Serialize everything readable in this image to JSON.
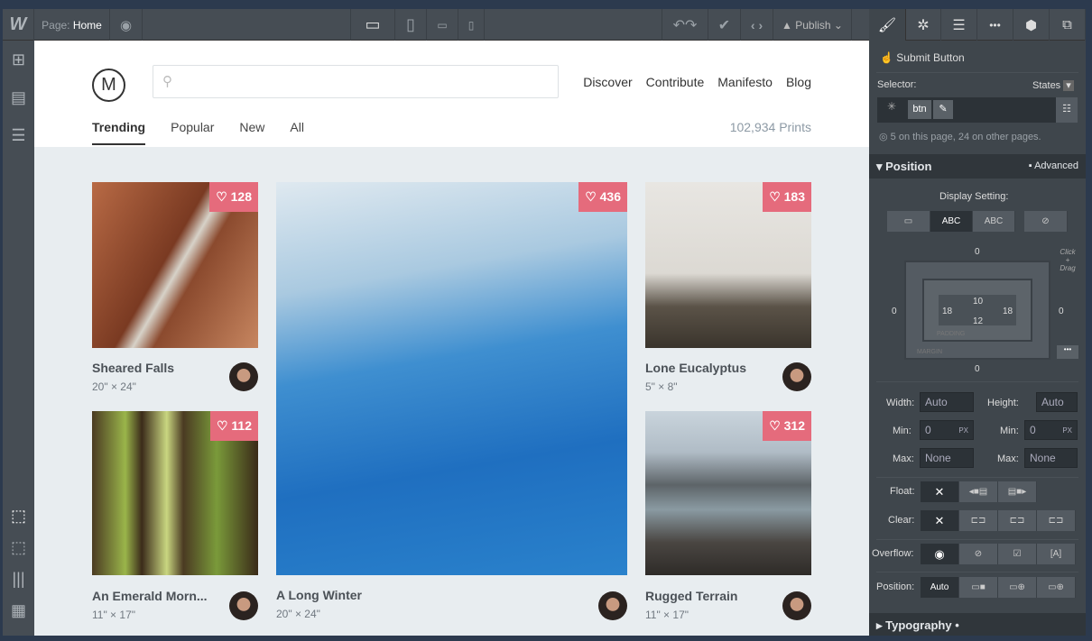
{
  "toolbar": {
    "logo": "W",
    "page_label": "Page:",
    "page_name": "Home",
    "publish": "Publish",
    "icons": [
      "webflow-logo",
      "eye-icon",
      "desktop-icon",
      "tablet-icon",
      "tablet-landscape-icon",
      "phone-icon",
      "undo-redo-icon",
      "check-icon",
      "code-icon",
      "rocket-icon"
    ],
    "panel_tabs": [
      "brush-icon",
      "gear-icon",
      "navigator-icon",
      "drops-icon",
      "cube-icon",
      "images-icon"
    ]
  },
  "sidebar": {
    "top": [
      "add-icon",
      "pages-icon",
      "database-icon"
    ],
    "bottom": [
      "select-icon",
      "preview-icon",
      "grid-icon",
      "layout-icon"
    ]
  },
  "site": {
    "logo": "M",
    "search_placeholder": "",
    "nav": [
      "Discover",
      "Contribute",
      "Manifesto",
      "Blog"
    ],
    "tabs": [
      "Trending",
      "Popular",
      "New",
      "All"
    ],
    "prints": "102,934 Prints",
    "cards": [
      {
        "title": "Sheared Falls",
        "size": "20\" × 24\"",
        "likes": "128"
      },
      {
        "title": "A Long Winter",
        "size": "20\" × 24\"",
        "likes": "436"
      },
      {
        "title": "Lone Eucalyptus",
        "size": "5\" × 8\"",
        "likes": "183"
      },
      {
        "title": "An Emerald Morn...",
        "size": "11\" × 17\"",
        "likes": "112"
      },
      {
        "title": "Rugged Terrain",
        "size": "11\" × 17\"",
        "likes": "312"
      }
    ]
  },
  "panel": {
    "element": "Submit Button",
    "selector_label": "Selector:",
    "states": "States",
    "class": "btn",
    "usage": "5 on this page, 24 on other pages.",
    "position_section": "Position",
    "advanced": "Advanced",
    "display_setting": "Display Setting:",
    "display_opts": [
      "",
      "ABC",
      "ABC",
      ""
    ],
    "box": {
      "margin_top": "0",
      "margin_left": "0",
      "margin_right": "0",
      "margin_bottom": "0",
      "padding_top": "10",
      "padding_left": "18",
      "padding_right": "18",
      "padding_bottom": "12",
      "padding_label": "PADDING",
      "margin_label": "MARGIN",
      "hint": "Click + Drag"
    },
    "width_label": "Width:",
    "width": "Auto",
    "height_label": "Height:",
    "height": "Auto",
    "min_label": "Min:",
    "min_w": "0",
    "min_h": "0",
    "unit": "PX",
    "max_label": "Max:",
    "max_w": "None",
    "max_h": "None",
    "float_label": "Float:",
    "clear_label": "Clear:",
    "overflow_label": "Overflow:",
    "position_label": "Position:",
    "position_value": "Auto",
    "typography": "Typography"
  }
}
